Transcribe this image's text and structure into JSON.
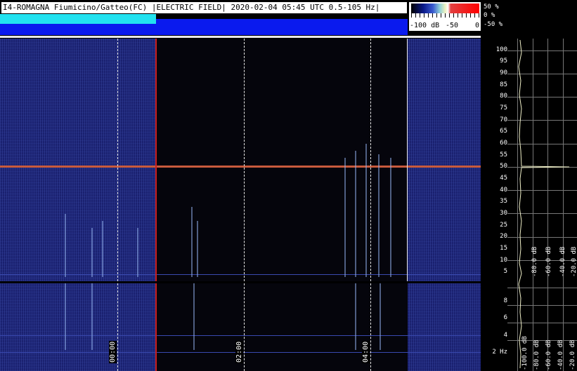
{
  "title": "I4-ROMAGNA Fiumicino/Gatteo(FC) |ELECTRIC FIELD| 2020-02-04 05:45 UTC 0.5-105 Hz|",
  "colorbar": {
    "min_label": "-100 dB",
    "mid_label": "-50",
    "max_label": "0"
  },
  "percent_labels": [
    "50 %",
    "0 %",
    "-50 %"
  ],
  "freq_scale_top": [
    "100",
    "95",
    "90",
    "85",
    "80",
    "75",
    "70",
    "65",
    "60",
    "55",
    "50",
    "45",
    "40",
    "35",
    "30",
    "25",
    "20",
    "15",
    "10",
    "5"
  ],
  "freq_scale_bottom": [
    "8",
    "6",
    "4",
    "2 Hz"
  ],
  "profile_db_top": [
    "-80.0 dB",
    "-60.0 dB",
    "-40.0 dB",
    "-20.0 dB"
  ],
  "profile_db_bottom": [
    "-100.0 dB",
    "-80.0 dB",
    "-60.0 dB",
    "-40.0 dB",
    "-20.0 dB"
  ],
  "time_labels": [
    "00:00",
    "02:00",
    "04:00"
  ],
  "colors": {
    "band": "#c85a3c",
    "spectrogram_bg": "#1a2170",
    "black_gap": "#05050c",
    "cyan_status": "#22e2f0",
    "blue_status": "#0a1aee"
  }
}
